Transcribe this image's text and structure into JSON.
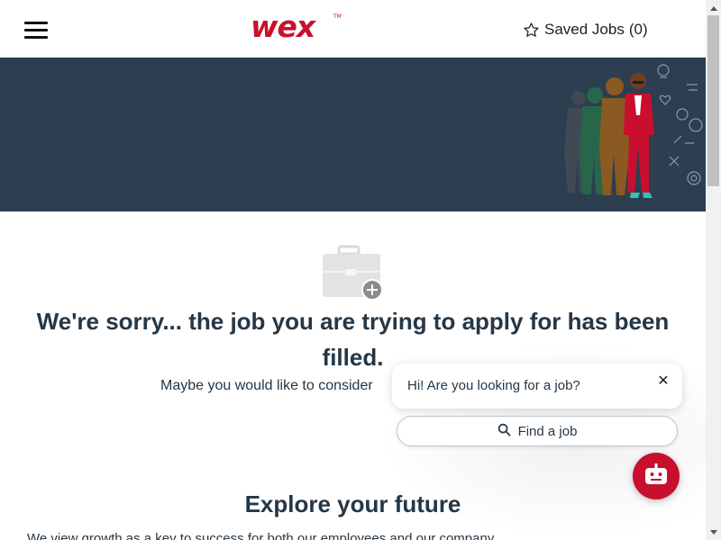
{
  "header": {
    "logo_text": "wex",
    "logo_tm": "TM",
    "saved_jobs_label": "Saved Jobs",
    "saved_jobs_count": "(0)"
  },
  "colors": {
    "brand_red": "#c8102e",
    "banner_bg": "#2c3e50",
    "text_dark": "#253746"
  },
  "icons": {
    "menu": "hamburger-menu-icon",
    "saved": "star-outline-icon",
    "job": "briefcase-plus-icon",
    "search": "search-icon",
    "close": "close-icon",
    "bot": "robot-icon"
  },
  "main": {
    "sorry_title": "We're sorry... the job you are trying to apply for has been filled.",
    "sorry_subtitle": "Maybe you would like to consider",
    "explore_title": "Explore your future",
    "explore_text": "We view growth as a key to success for both our employees and our company"
  },
  "chat": {
    "greeting": "Hi! Are you looking for a job?",
    "close_symbol": "✕",
    "find_job_label": "Find a job"
  }
}
